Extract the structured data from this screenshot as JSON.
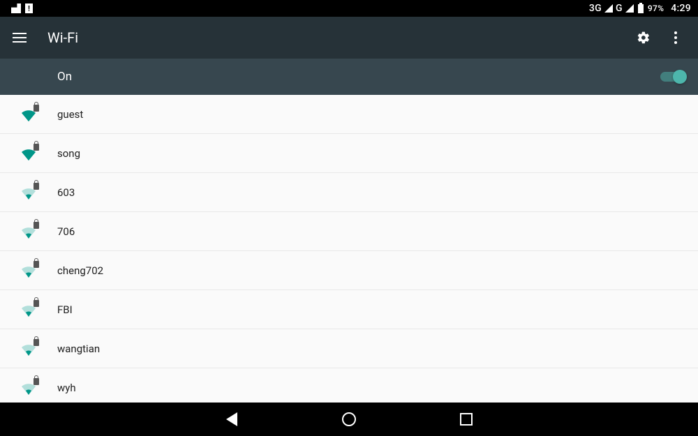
{
  "status": {
    "network_label": "3G",
    "network_label2": "G",
    "battery_pct": "97%",
    "time": "4:29"
  },
  "header": {
    "title": "Wi-Fi"
  },
  "toggle": {
    "label": "On",
    "state": true
  },
  "networks": [
    {
      "ssid": "guest",
      "strength": "strong",
      "secured": true
    },
    {
      "ssid": "song",
      "strength": "strong",
      "secured": true
    },
    {
      "ssid": "603",
      "strength": "weak",
      "secured": true
    },
    {
      "ssid": "706",
      "strength": "weak",
      "secured": true
    },
    {
      "ssid": "cheng702",
      "strength": "weak",
      "secured": true
    },
    {
      "ssid": "FBI",
      "strength": "weak",
      "secured": true
    },
    {
      "ssid": "wangtian",
      "strength": "weak",
      "secured": true
    },
    {
      "ssid": "wyh",
      "strength": "weak",
      "secured": true
    }
  ],
  "colors": {
    "accent": "#4db6ac",
    "appbar": "#263238",
    "subbar": "#37474f"
  }
}
